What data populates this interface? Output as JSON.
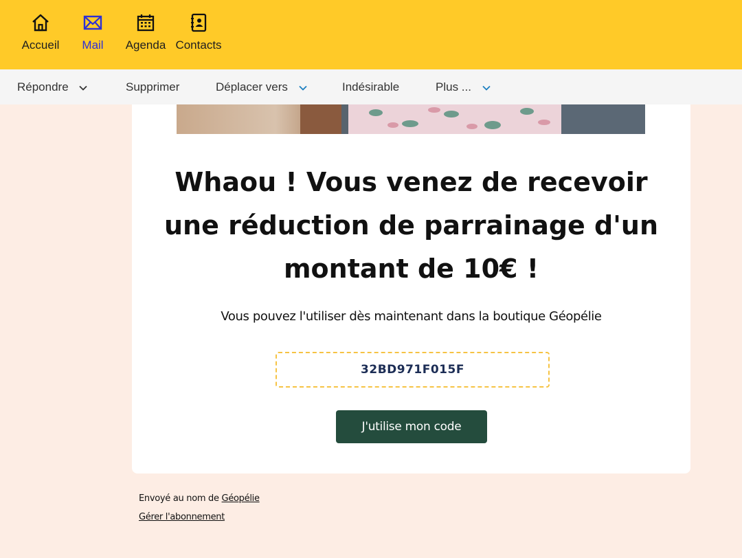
{
  "nav": {
    "items": [
      {
        "label": "Accueil",
        "icon": "home-icon"
      },
      {
        "label": "Mail",
        "icon": "mail-icon",
        "active": true
      },
      {
        "label": "Agenda",
        "icon": "calendar-icon"
      },
      {
        "label": "Contacts",
        "icon": "contacts-icon"
      }
    ]
  },
  "toolbar": {
    "reply": "Répondre",
    "delete": "Supprimer",
    "move": "Déplacer vers",
    "junk": "Indésirable",
    "more": "Plus ..."
  },
  "email": {
    "headline": "Whaou ! Vous venez de recevoir une réduction de parrainage d'un montant de 10€ !",
    "subline": "Vous pouvez l'utiliser dès maintenant dans la boutique Géopélie",
    "code": "32BD971F015F",
    "cta": "J'utilise mon code"
  },
  "footer": {
    "sent_prefix": "Envoyé au nom de ",
    "sender": "Géopélie",
    "manage": "Gérer l'abonnement"
  },
  "colors": {
    "topbar": "#ffca28",
    "active_nav": "#2c2fd6",
    "page_bg": "#fdede4",
    "cta_bg": "#244c3d",
    "code_border": "#f6c343"
  }
}
